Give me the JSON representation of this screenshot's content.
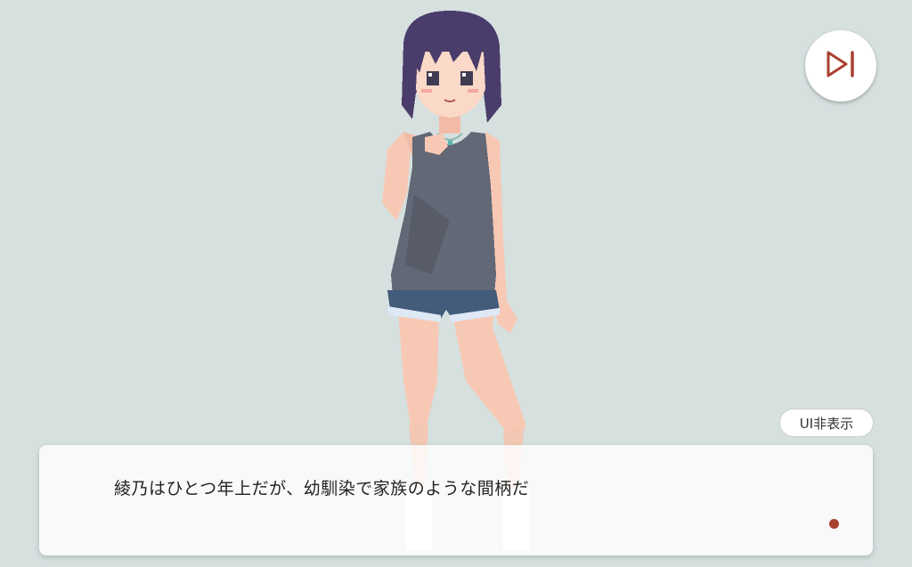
{
  "scene": {
    "background_color": "#d6e0df",
    "character": {
      "hair_color": "#4a3d6b",
      "top_color": "#626875",
      "shorts_color": "#425c7a",
      "skin_color": "#f7c9b4"
    }
  },
  "controls": {
    "skip": {
      "icon": "skip-forward-icon",
      "color": "#a8402f"
    },
    "hide_ui_label": "UI非表示"
  },
  "message": {
    "text": "綾乃はひとつ年上だが、幼馴染で家族のような間柄だ",
    "indicator_color": "#a8402f"
  }
}
